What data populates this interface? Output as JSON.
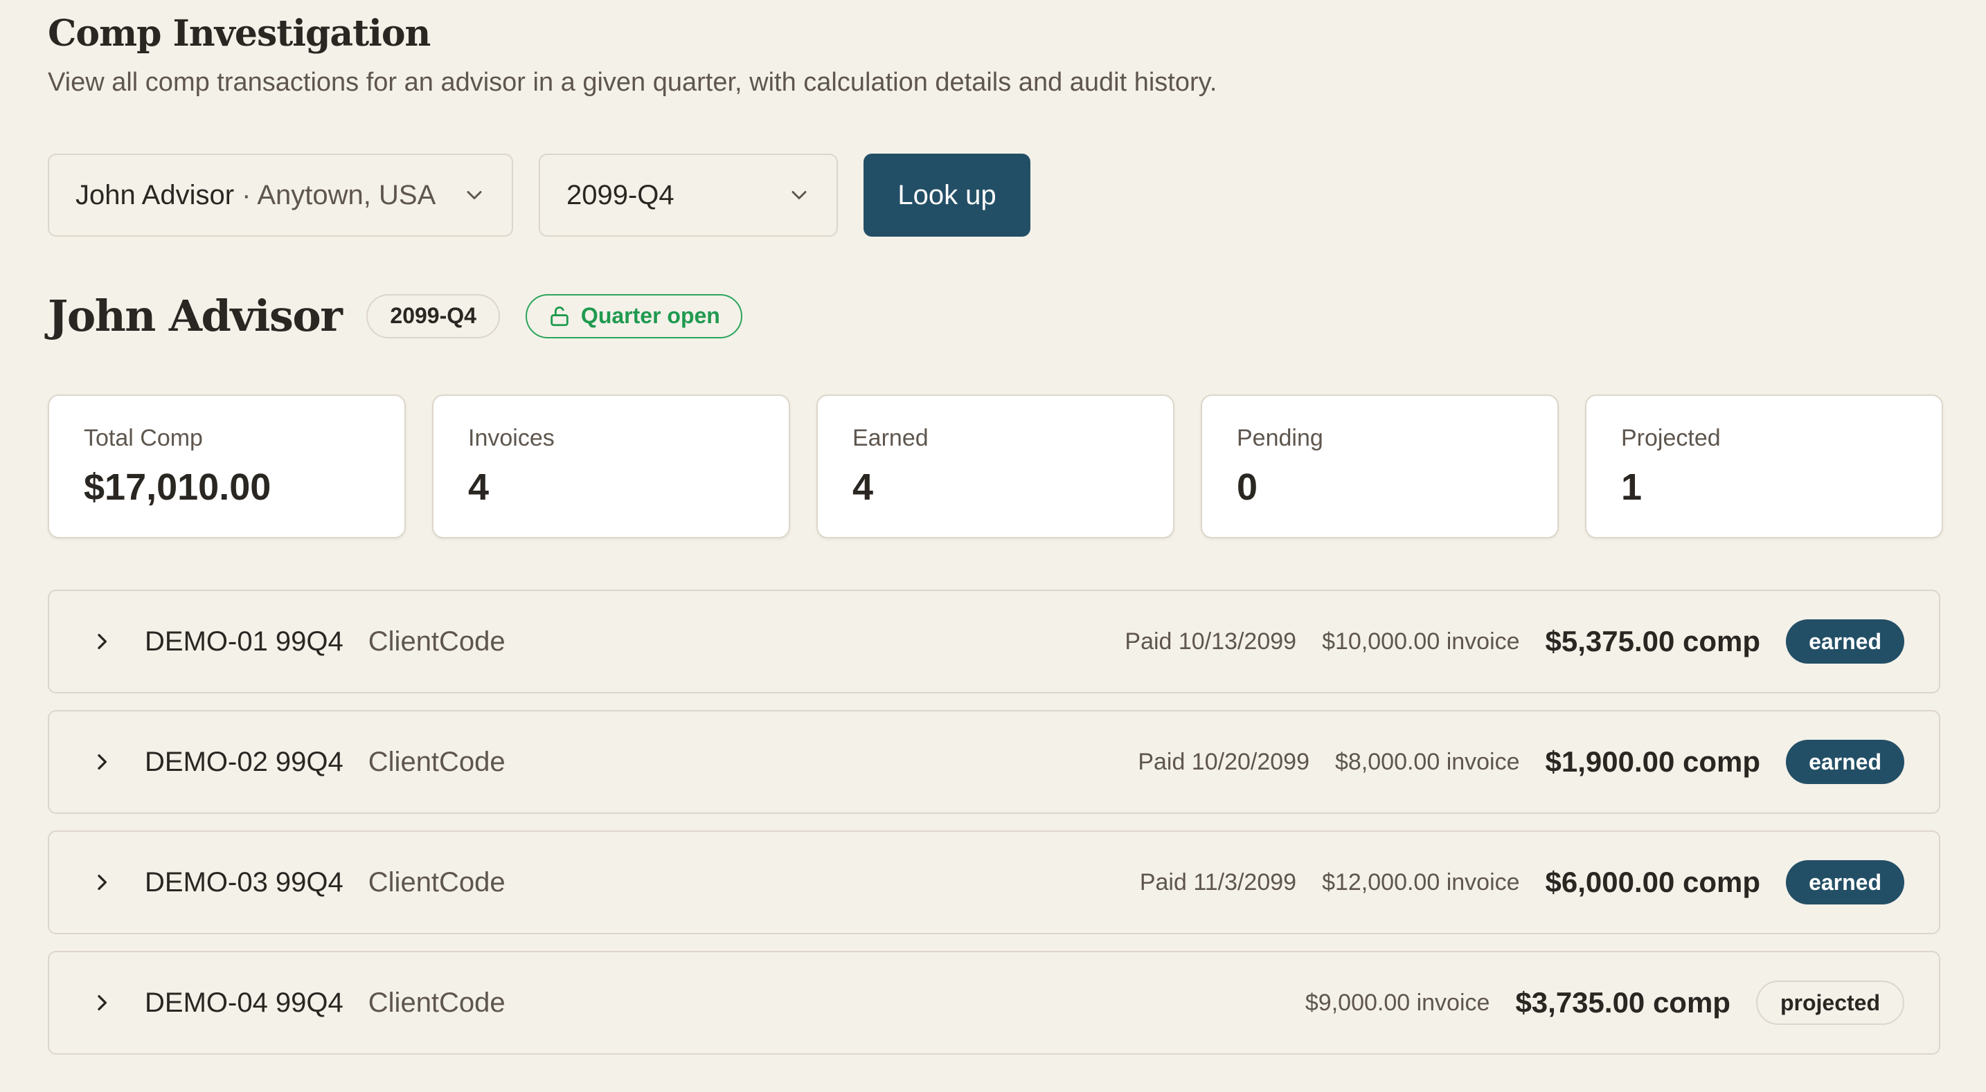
{
  "header": {
    "title": "Comp Investigation",
    "subtitle": "View all comp transactions for an advisor in a given quarter, with calculation details and audit history."
  },
  "controls": {
    "advisor_name": "John Advisor",
    "advisor_location": " · Anytown, USA",
    "quarter_value": "2099-Q4",
    "lookup_label": "Look up"
  },
  "advisor": {
    "name": "John Advisor",
    "quarter": "2099-Q4",
    "status": "Quarter open",
    "status_color": "#1f9a4f"
  },
  "stats": [
    {
      "label": "Total Comp",
      "value": "$17,010.00"
    },
    {
      "label": "Invoices",
      "value": "4"
    },
    {
      "label": "Earned",
      "value": "4"
    },
    {
      "label": "Pending",
      "value": "0"
    },
    {
      "label": "Projected",
      "value": "1"
    }
  ],
  "transactions": [
    {
      "id": "DEMO-01 99Q4",
      "client": "ClientCode",
      "paid": "Paid 10/13/2099",
      "invoice": "$10,000.00 invoice",
      "comp": "$5,375.00 comp",
      "status": "earned"
    },
    {
      "id": "DEMO-02 99Q4",
      "client": "ClientCode",
      "paid": "Paid 10/20/2099",
      "invoice": "$8,000.00 invoice",
      "comp": "$1,900.00 comp",
      "status": "earned"
    },
    {
      "id": "DEMO-03 99Q4",
      "client": "ClientCode",
      "paid": "Paid 11/3/2099",
      "invoice": "$12,000.00 invoice",
      "comp": "$6,000.00 comp",
      "status": "earned"
    },
    {
      "id": "DEMO-04 99Q4",
      "client": "ClientCode",
      "paid": "",
      "invoice": "$9,000.00 invoice",
      "comp": "$3,735.00 comp",
      "status": "projected"
    }
  ],
  "colors": {
    "background": "#f4f1e9",
    "primary": "#234f66",
    "open_green": "#1f9a4f"
  }
}
